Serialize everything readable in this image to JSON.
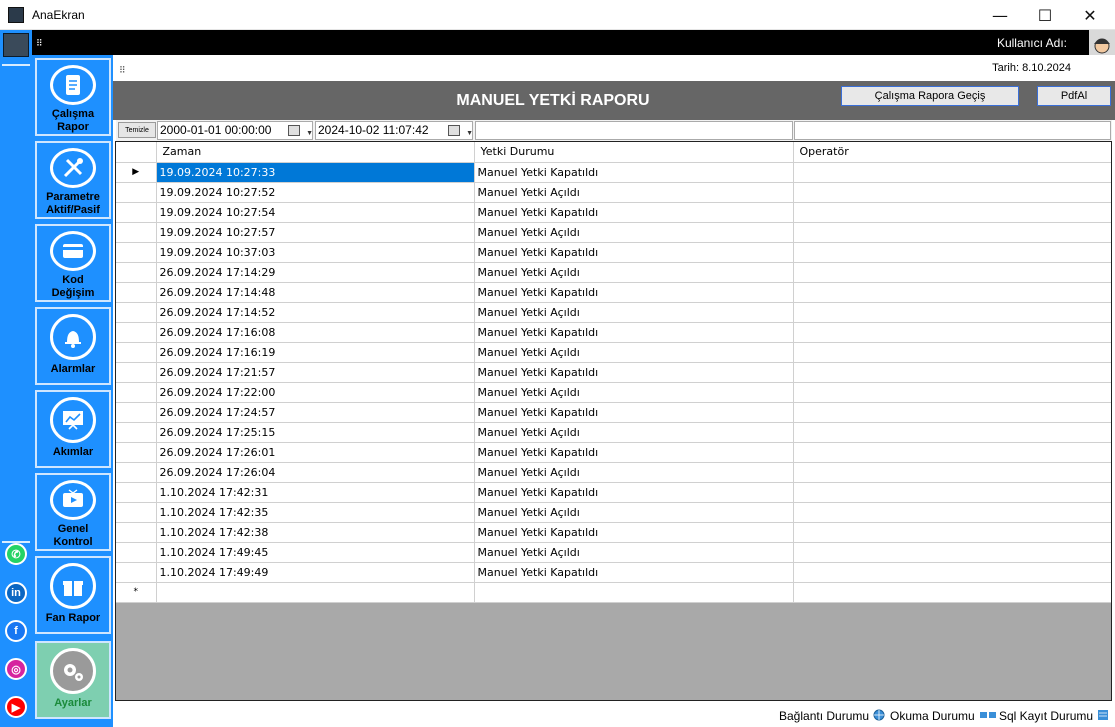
{
  "window": {
    "title": "AnaEkran",
    "minimize": "—",
    "maximize": "☐",
    "close": "✕"
  },
  "topbar": {
    "user_label": "Kullanıcı Adı:"
  },
  "subbar": {
    "date_label": "Tarih: 8.10.2024"
  },
  "nav": [
    {
      "label": "Çalışma\nRapor",
      "icon": "document-icon"
    },
    {
      "label": "Parametre\nAktif/Pasif",
      "icon": "tools-icon"
    },
    {
      "label": "Kod\nDeğişim",
      "icon": "card-icon"
    },
    {
      "label": "Alarmlar",
      "icon": "bell-icon"
    },
    {
      "label": "Akımlar",
      "icon": "chart-board-icon"
    },
    {
      "label": "Genel\nKontrol",
      "icon": "tv-icon"
    },
    {
      "label": "Fan Rapor",
      "icon": "gift-icon"
    },
    {
      "label": "Ayarlar",
      "icon": "gears-icon"
    }
  ],
  "social": [
    {
      "icon": "whatsapp-icon",
      "color": "#25d366"
    },
    {
      "icon": "linkedin-icon",
      "color": "#0a66c2"
    },
    {
      "icon": "facebook-icon",
      "color": "#1877f2"
    },
    {
      "icon": "instagram-icon",
      "color": "#d6249f"
    },
    {
      "icon": "youtube-icon",
      "color": "#ff0000"
    }
  ],
  "report": {
    "title": "MANUEL YETKİ RAPORU",
    "btn_switch": "Çalışma Rapora Geçiş",
    "btn_pdf": "PdfAl"
  },
  "filter": {
    "clear_label": "Temizle",
    "date_from": "2000-01-01 00:00:00",
    "date_to": "2024-10-02 11:07:42"
  },
  "grid": {
    "columns": [
      "Zaman",
      "Yetki Durumu",
      "Operatör"
    ],
    "rows": [
      [
        "19.09.2024 10:27:33",
        "Manuel Yetki Kapatıldı",
        ""
      ],
      [
        "19.09.2024 10:27:52",
        "Manuel Yetki Açıldı",
        ""
      ],
      [
        "19.09.2024 10:27:54",
        "Manuel Yetki Kapatıldı",
        ""
      ],
      [
        "19.09.2024 10:27:57",
        "Manuel Yetki Açıldı",
        ""
      ],
      [
        "19.09.2024 10:37:03",
        "Manuel Yetki Kapatıldı",
        ""
      ],
      [
        "26.09.2024 17:14:29",
        "Manuel Yetki Açıldı",
        ""
      ],
      [
        "26.09.2024 17:14:48",
        "Manuel Yetki Kapatıldı",
        ""
      ],
      [
        "26.09.2024 17:14:52",
        "Manuel Yetki Açıldı",
        ""
      ],
      [
        "26.09.2024 17:16:08",
        "Manuel Yetki Kapatıldı",
        ""
      ],
      [
        "26.09.2024 17:16:19",
        "Manuel Yetki Açıldı",
        ""
      ],
      [
        "26.09.2024 17:21:57",
        "Manuel Yetki Kapatıldı",
        ""
      ],
      [
        "26.09.2024 17:22:00",
        "Manuel Yetki Açıldı",
        ""
      ],
      [
        "26.09.2024 17:24:57",
        "Manuel Yetki Kapatıldı",
        ""
      ],
      [
        "26.09.2024 17:25:15",
        "Manuel Yetki Açıldı",
        ""
      ],
      [
        "26.09.2024 17:26:01",
        "Manuel Yetki Kapatıldı",
        ""
      ],
      [
        "26.09.2024 17:26:04",
        "Manuel Yetki Açıldı",
        ""
      ],
      [
        "1.10.2024 17:42:31",
        "Manuel Yetki Kapatıldı",
        ""
      ],
      [
        "1.10.2024 17:42:35",
        "Manuel Yetki Açıldı",
        ""
      ],
      [
        "1.10.2024 17:42:38",
        "Manuel Yetki Kapatıldı",
        ""
      ],
      [
        "1.10.2024 17:49:45",
        "Manuel Yetki Açıldı",
        ""
      ],
      [
        "1.10.2024 17:49:49",
        "Manuel Yetki Kapatıldı",
        ""
      ]
    ],
    "selected_row_marker": "▶",
    "new_row_marker": "*"
  },
  "status": {
    "connection": "Bağlantı Durumu",
    "reading": "Okuma Durumu",
    "sql": "Sql Kayıt Durumu"
  },
  "colors": {
    "accent": "#1e90ff",
    "selection": "#0078d7",
    "header_bg": "#666666"
  }
}
